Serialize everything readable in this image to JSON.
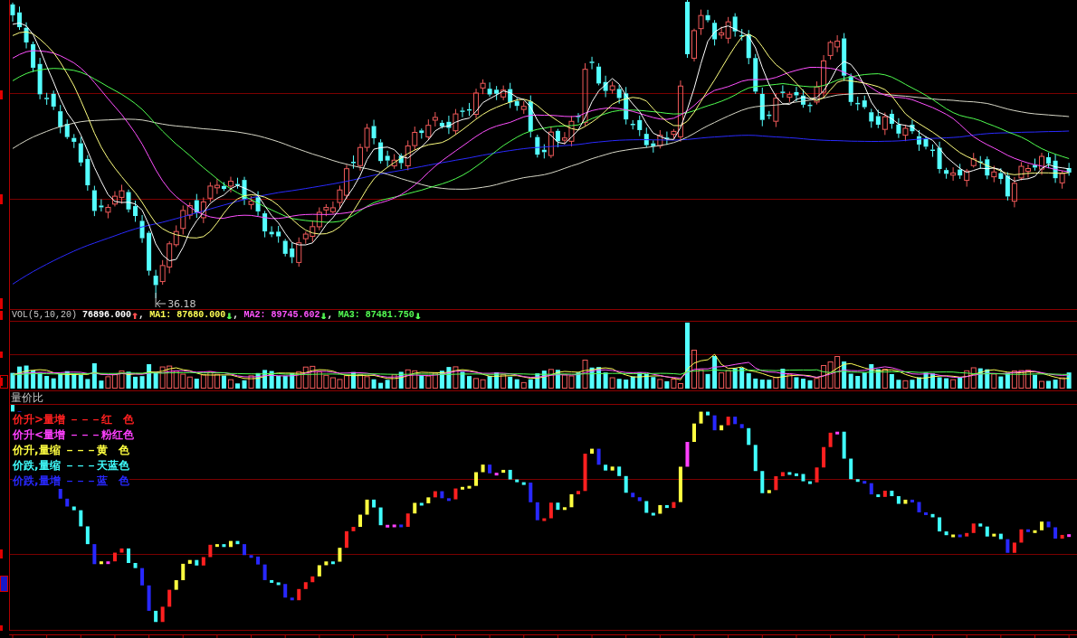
{
  "price_panel": {
    "low_label": "36.18"
  },
  "volume_panel": {
    "title": "VOL(5,10,20)",
    "separator": ",",
    "readings": [
      {
        "text": "76896.000",
        "color": "#ffffff",
        "arrow": {
          "text": "↑",
          "color": "#ff5050"
        }
      },
      {
        "text": "MA1: 87680.000",
        "color": "#ffff54",
        "arrow": {
          "text": "↓",
          "color": "#54ff54"
        }
      },
      {
        "text": "MA2: 89745.602",
        "color": "#ff54ff",
        "arrow": {
          "text": "↓",
          "color": "#54ff54"
        }
      },
      {
        "text": "MA3: 87481.750",
        "color": "#54ff54",
        "arrow": {
          "text": "↓",
          "color": "#54ff54"
        }
      }
    ]
  },
  "ratio_panel": {
    "title": "量价比",
    "legend": [
      {
        "text": "价升>量增 －－－红　色",
        "color": "#ff2020"
      },
      {
        "text": "价升<量增 －－－粉红色",
        "color": "#ff40ff"
      },
      {
        "text": "价升,量缩 －－－黄　色",
        "color": "#ffff40"
      },
      {
        "text": "价跌,量缩 －－－天蓝色",
        "color": "#40ffff"
      },
      {
        "text": "价跌,量增 －－－蓝　色",
        "color": "#2828ff"
      }
    ]
  }
}
